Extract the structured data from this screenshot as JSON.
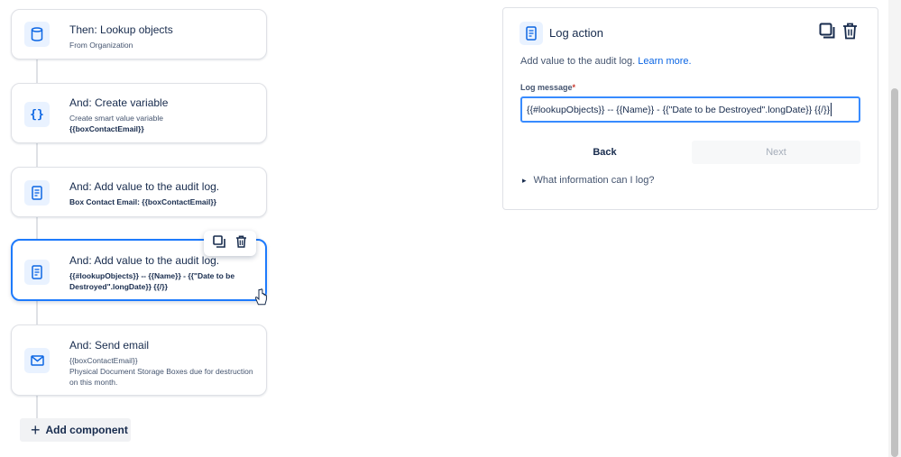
{
  "steps": [
    {
      "title": "Then: Lookup objects",
      "sub": "From Organization",
      "icon": "database-icon"
    },
    {
      "title": "And: Create variable",
      "sub": "Create smart value variable",
      "sub2": "{{boxContactEmail}}",
      "icon": "braces-icon"
    },
    {
      "title": "And: Add value to the audit log.",
      "sub": "Box Contact Email: {{boxContactEmail}}",
      "icon": "log-icon"
    },
    {
      "title": "And: Add value to the audit log.",
      "sub": "{{#lookupObjects}} -- {{Name}} - {{\"Date to be Destroyed\".longDate}} {{/}}",
      "icon": "log-icon"
    },
    {
      "title": "And: Send email",
      "sub": "{{boxContactEmail}}",
      "sub2": "Physical Document Storage Boxes due for destruction on this month.",
      "icon": "mail-icon"
    }
  ],
  "add_component": {
    "label": "Add component"
  },
  "panel": {
    "title": "Log action",
    "description": "Add value to the audit log.",
    "learn_more": "Learn more.",
    "field_label": "Log message",
    "required_mark": "*",
    "field_value": "{{#lookupObjects}}   -- {{Name}} - {{\"Date to be Destroyed\".longDate}}  {{/}}",
    "back_label": "Back",
    "next_label": "Next",
    "expand_label": "What information can I log?"
  },
  "colors": {
    "accent": "#1d7afc",
    "link": "#0c66e4",
    "icon_bg": "#e9f2ff"
  }
}
